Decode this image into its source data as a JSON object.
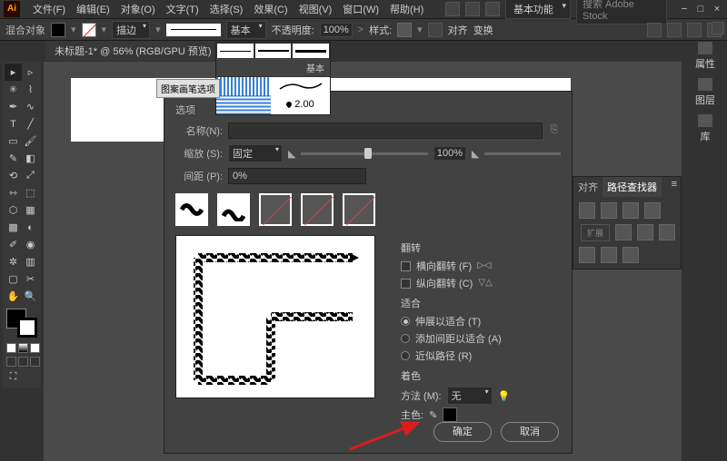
{
  "menubar": {
    "items": [
      "文件(F)",
      "编辑(E)",
      "对象(O)",
      "文字(T)",
      "选择(S)",
      "效果(C)",
      "视图(V)",
      "窗口(W)",
      "帮助(H)"
    ]
  },
  "topbar": {
    "workspace": "基本功能",
    "search_placeholder": "搜索 Adobe Stock"
  },
  "ctrlbar": {
    "label": "混合对象",
    "stroke_dd": "描边",
    "stroke_basic": "基本",
    "opacity_label": "不透明度:",
    "opacity": "100%",
    "style_label": "样式:",
    "group": [
      "对齐",
      "变换"
    ]
  },
  "tabs": {
    "doc": "未标题-1* @ 56% (RGB/GPU 预览)"
  },
  "right_dock": [
    {
      "icon": "properties",
      "label": "属性"
    },
    {
      "icon": "layers",
      "label": "图层"
    },
    {
      "icon": "libraries",
      "label": "库"
    }
  ],
  "brush_popup": {
    "label": "基本",
    "size": "2.00"
  },
  "dialog_tag": "图案画笔选项",
  "dialog": {
    "section": "选项",
    "name_label": "名称(N):",
    "name_value": "",
    "scale_label": "缩放 (S):",
    "scale_mode": "固定",
    "scale_val": "100%",
    "spacing_label": "间距 (P):",
    "spacing_val": "0%",
    "flip": {
      "title": "翻转",
      "h": "横向翻转 (F)",
      "v": "纵向翻转 (C)"
    },
    "fit": {
      "title": "适合",
      "opts": [
        "伸展以适合 (T)",
        "添加间距以适合 (A)",
        "近似路径 (R)"
      ],
      "selected": 0
    },
    "colorize": {
      "title": "着色",
      "method_label": "方法 (M):",
      "method": "无",
      "key_label": "主色:"
    },
    "ok": "确定",
    "cancel": "取消"
  },
  "pathfinder": {
    "tabs": [
      "对齐",
      "路径查找器"
    ],
    "expand": "扩展"
  },
  "chart_data": null
}
